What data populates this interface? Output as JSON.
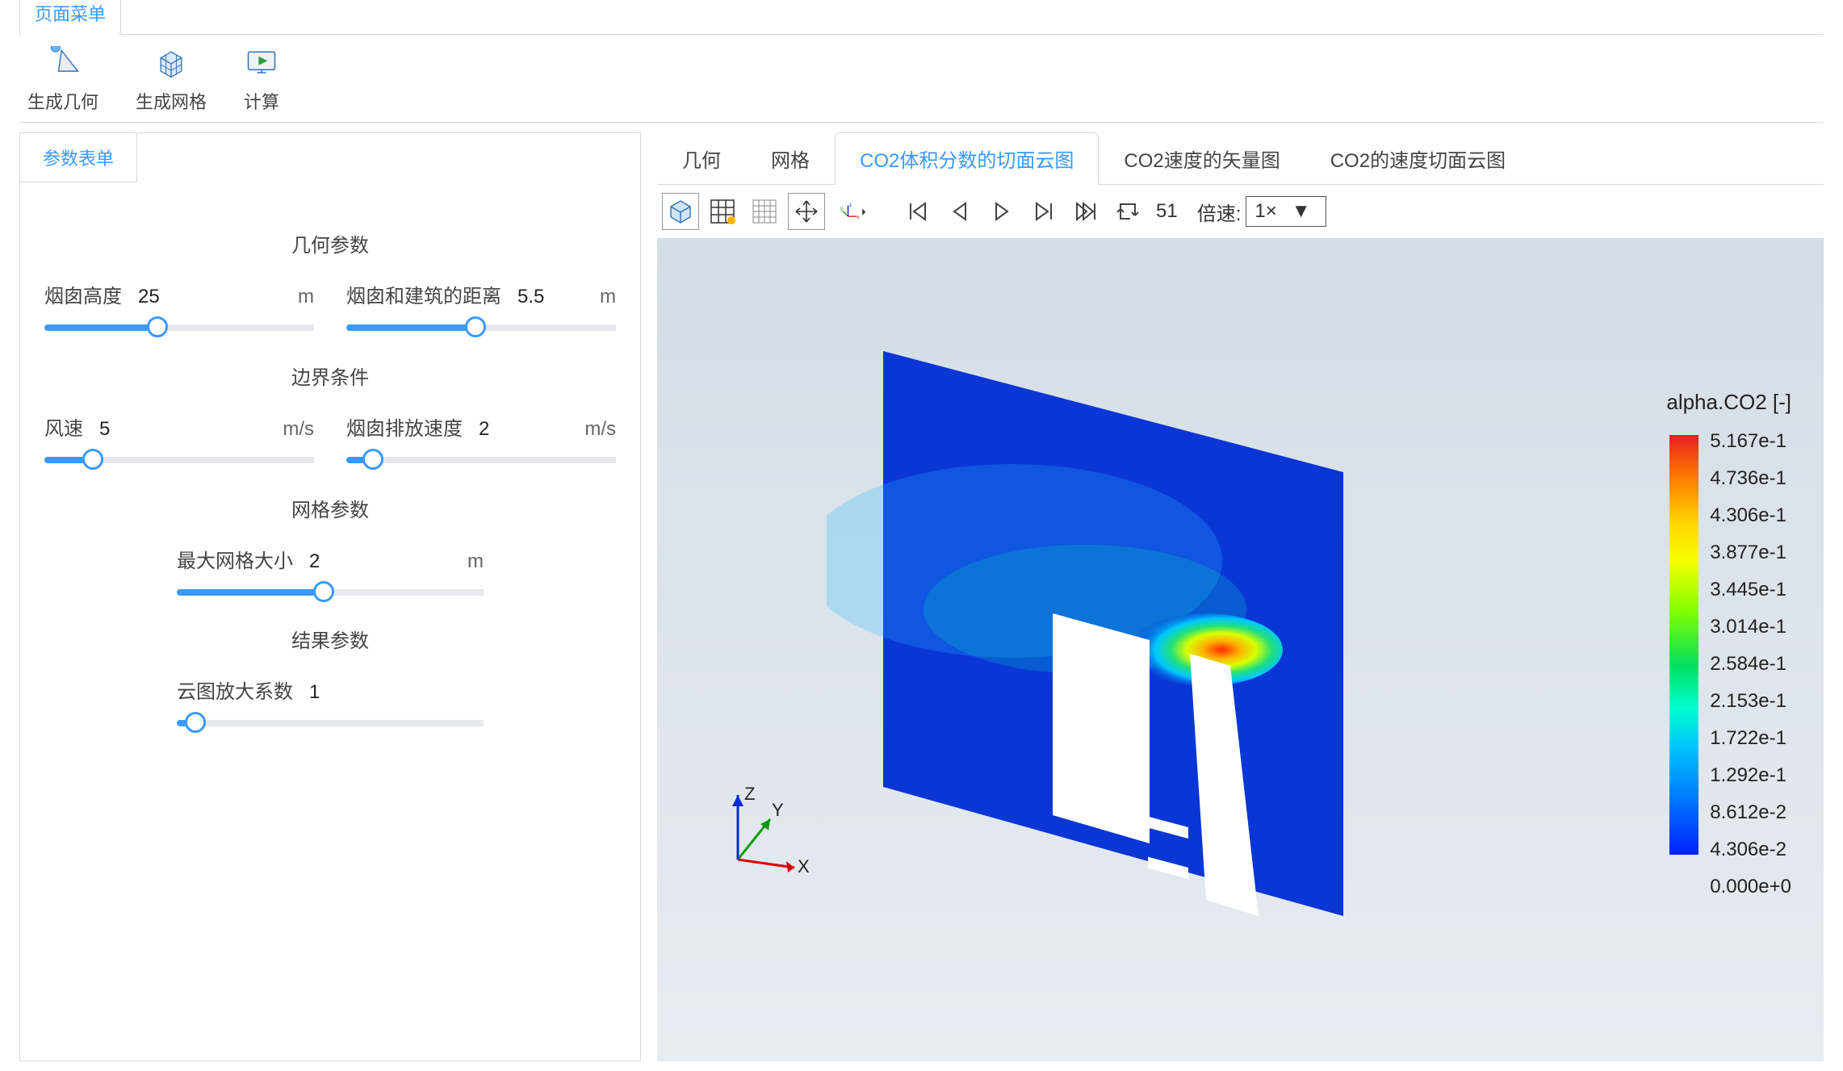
{
  "top_tab": "页面菜单",
  "ribbon": {
    "geom_label": "生成几何",
    "mesh_label": "生成网格",
    "calc_label": "计算"
  },
  "sidebar": {
    "tab_label": "参数表单",
    "sections": {
      "geom_title": "几何参数",
      "bc_title": "边界条件",
      "mesh_title": "网格参数",
      "result_title": "结果参数"
    },
    "sliders": {
      "chimney_height": {
        "label": "烟囱高度",
        "value": "25",
        "unit": "m",
        "pct": 42
      },
      "chimney_dist": {
        "label": "烟囱和建筑的距离",
        "value": "5.5",
        "unit": "m",
        "pct": 48
      },
      "wind_speed": {
        "label": "风速",
        "value": "5",
        "unit": "m/s",
        "pct": 18
      },
      "emit_speed": {
        "label": "烟囱排放速度",
        "value": "2",
        "unit": "m/s",
        "pct": 10
      },
      "max_mesh": {
        "label": "最大网格大小",
        "value": "2",
        "unit": "m",
        "pct": 48
      },
      "zoom_factor": {
        "label": "云图放大系数",
        "value": "1",
        "unit": "",
        "pct": 6
      }
    }
  },
  "viewer": {
    "tabs": {
      "geom": "几何",
      "mesh": "网格",
      "co2_slice": "CO2体积分数的切面云图",
      "co2_vector": "CO2速度的矢量图",
      "co2_speed_slice": "CO2的速度切面云图"
    },
    "frame_number": "51",
    "speed_label": "倍速:",
    "speed_value": "1×",
    "legend_title": "alpha.CO2 [-]",
    "legend_ticks": [
      "5.167e-1",
      "4.736e-1",
      "4.306e-1",
      "3.877e-1",
      "3.445e-1",
      "3.014e-1",
      "2.584e-1",
      "2.153e-1",
      "1.722e-1",
      "1.292e-1",
      "8.612e-2",
      "4.306e-2",
      "0.000e+0"
    ],
    "triad": {
      "x": "X",
      "y": "Y",
      "z": "Z"
    }
  }
}
